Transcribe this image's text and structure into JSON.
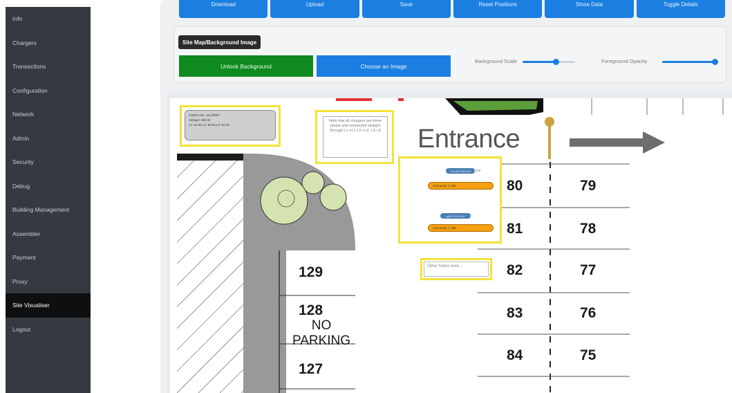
{
  "sidebar": {
    "items": [
      {
        "label": "Info"
      },
      {
        "label": "Chargers"
      },
      {
        "label": "Transactions"
      },
      {
        "label": "Configuration"
      },
      {
        "label": "Network"
      },
      {
        "label": "Admin"
      },
      {
        "label": "Security"
      },
      {
        "label": "Debug"
      },
      {
        "label": "Building Management"
      },
      {
        "label": "Assembler"
      },
      {
        "label": "Payment"
      },
      {
        "label": "Proxy"
      },
      {
        "label": "Site Visualiser",
        "active": true
      },
      {
        "label": "Logout"
      }
    ]
  },
  "toolbar": {
    "buttons": [
      "Download",
      "Upload",
      "Save",
      "Reset Positions",
      "Show Data",
      "Toggle Details"
    ]
  },
  "site_map": {
    "title": "Site Map/Background Image",
    "unlock_label": "Unlock Background",
    "choose_label": "Choose an Image",
    "bg_scale_label": "Background Scale",
    "bg_scale_value": 0.6,
    "fg_opacity_label": "Foreground Opacity",
    "fg_opacity_value": 1.0
  },
  "map": {
    "entrance_label": "Entrance",
    "meter_box": {
      "line1": "CSMS URL: ws://0087",
      "line2": "Voltage: 230.40",
      "line3": "L1: 91.00 L2: 90.83 L3: 94.30"
    },
    "note_text": "Note that all chargers are three phase and connected straight through L1->L1 L2->L2, L3->3",
    "chargers": [
      {
        "id": "TACW224521AH",
        "suffix": "v72",
        "connector": "Connector 1: idle"
      },
      {
        "id": "gaE21234 5AA",
        "connector": "Connector 1: idle"
      }
    ],
    "other_notes_placeholder": "Other Notes here...",
    "bays_left": [
      "129",
      "128",
      "127"
    ],
    "no_parking": "NO\nPARKING",
    "bays_mid": [
      "80",
      "81",
      "82",
      "83",
      "84"
    ],
    "bays_right": [
      "79",
      "78",
      "77",
      "76",
      "75"
    ]
  },
  "colors": {
    "sidebar_bg": "#343a40",
    "accent_blue": "#1a7fe0",
    "unlock_green": "#0f8a1e",
    "highlight_yellow": "#f4e23a",
    "charger_orange": "#f5a00f",
    "charger_id_blue": "#4a7fb5"
  }
}
